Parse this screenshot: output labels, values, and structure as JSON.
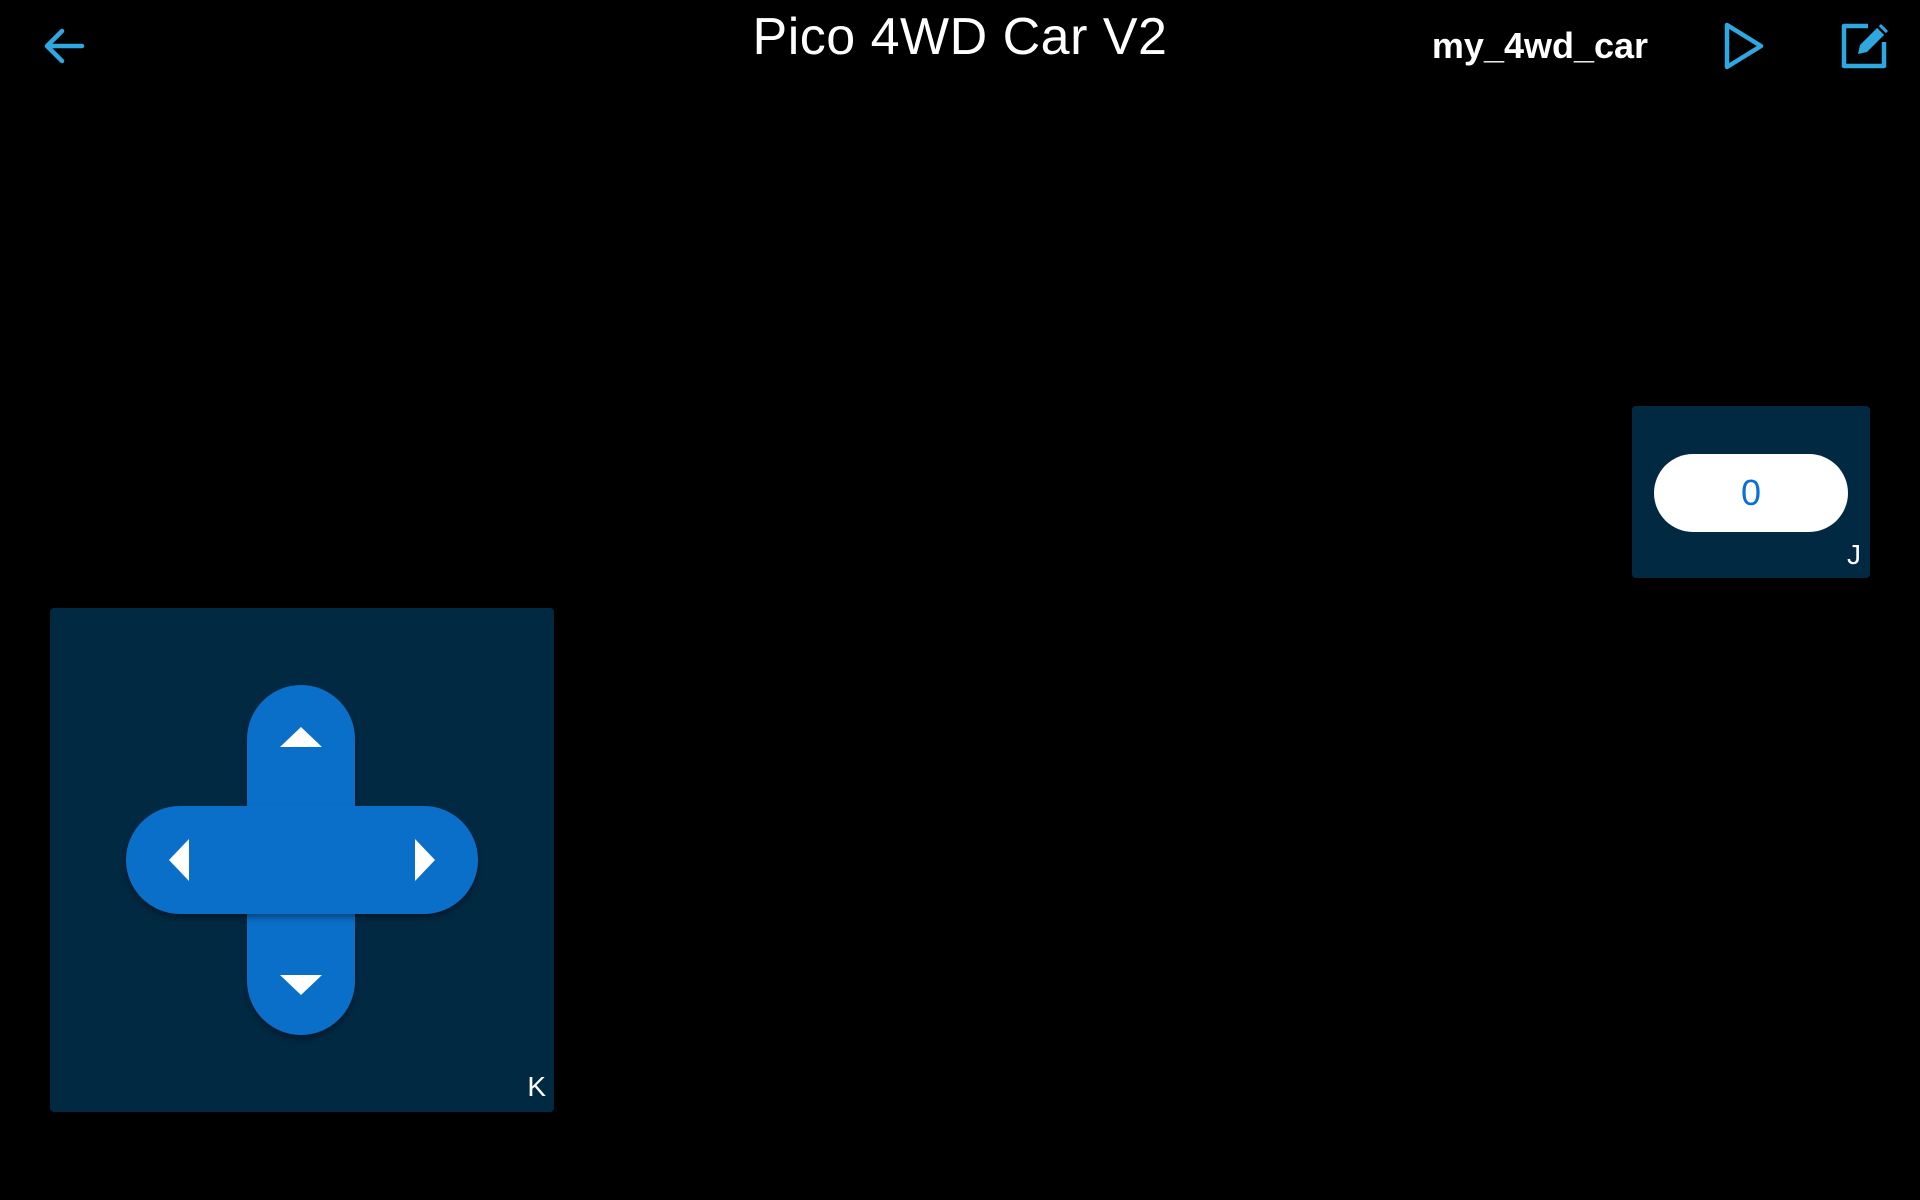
{
  "header": {
    "title": "Pico 4WD Car V2",
    "project_name": "my_4wd_car",
    "back_icon": "arrow-left-icon",
    "play_icon": "play-icon",
    "edit_icon": "edit-icon"
  },
  "widgets": {
    "number_widget": {
      "letter": "J",
      "value": "0"
    },
    "dpad_widget": {
      "letter": "K"
    }
  },
  "colors": {
    "background": "#000000",
    "accent": "#2fa8e0",
    "widget_panel": "#022942",
    "dpad_blue": "#0a6fc9",
    "value_text": "#0a6fd6"
  }
}
